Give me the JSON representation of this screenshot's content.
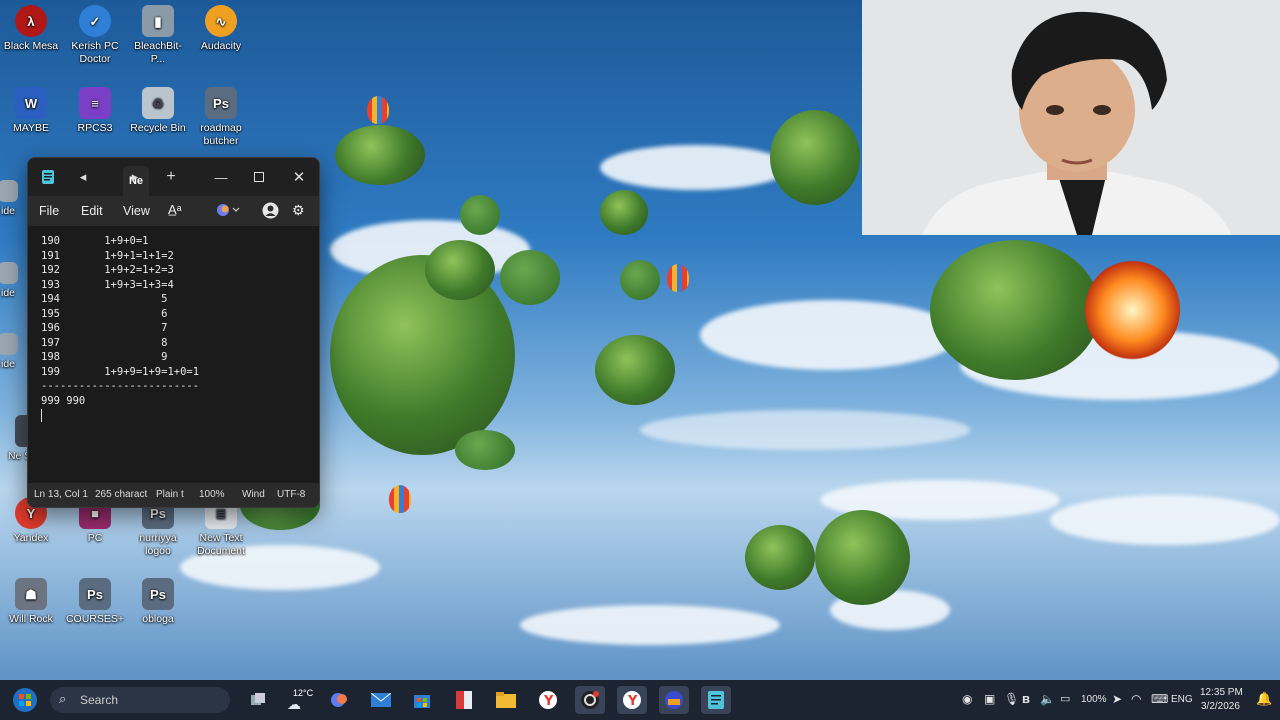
{
  "desktop_icons": [
    {
      "label": "Black Mesa",
      "icon": "black-mesa-icon",
      "color": "#b01818"
    },
    {
      "label": "Kerish PC Doctor",
      "icon": "kerish-icon",
      "color": "#2f7fd6"
    },
    {
      "label": "BleachBit-P...",
      "icon": "bleachbit-icon",
      "color": "#8a9aa8"
    },
    {
      "label": "Audacity",
      "icon": "audacity-icon",
      "color": "#f0a020"
    },
    {
      "label": "MAYBE",
      "icon": "word-icon",
      "color": "#2b5fbf"
    },
    {
      "label": "RPCS3",
      "icon": "rpcs3-icon",
      "color": "#7a3fc4"
    },
    {
      "label": "Recycle Bin",
      "icon": "recycle-bin-icon",
      "color": "#b9c4cc"
    },
    {
      "label": "roadmap butcher",
      "icon": "photoshop-icon",
      "color": "#5b6c80"
    },
    {
      "label": "ide",
      "icon": "file-icon",
      "color": "#9aa6b2"
    },
    {
      "label": "ide",
      "icon": "file-icon",
      "color": "#9aa6b2"
    },
    {
      "label": "ide",
      "icon": "file-icon",
      "color": "#9aa6b2"
    },
    {
      "label": "Ne Speec",
      "icon": "speech-icon",
      "color": "#444c58"
    },
    {
      "label": "Yandex",
      "icon": "yandex-icon",
      "color": "#e23b2e"
    },
    {
      "label": "PC",
      "icon": "pc-icon",
      "color": "#9b2c6e"
    },
    {
      "label": "nurriyya logoo",
      "icon": "photoshop-icon",
      "color": "#5b6c80"
    },
    {
      "label": "New Text Document",
      "icon": "text-file-icon",
      "color": "#e9edf1"
    },
    {
      "label": "Will Rock",
      "icon": "will-rock-icon",
      "color": "#6b7480"
    },
    {
      "label": "COURSES+",
      "icon": "photoshop-icon",
      "color": "#5b6c80"
    },
    {
      "label": "obloga",
      "icon": "photoshop-icon",
      "color": "#5b6c80"
    }
  ],
  "notepad": {
    "tab_label": "Ne",
    "menu": {
      "file": "File",
      "edit": "Edit",
      "view": "View"
    },
    "lines": [
      {
        "num": "190",
        "text": "1+9+0=1"
      },
      {
        "num": "191",
        "text": "1+9+1=1+1=2"
      },
      {
        "num": "192",
        "text": "1+9+2=1+2=3"
      },
      {
        "num": "193",
        "text": "1+9+3=1+3=4"
      },
      {
        "num": "194",
        "text": "         5"
      },
      {
        "num": "195",
        "text": "         6"
      },
      {
        "num": "196",
        "text": "         7"
      },
      {
        "num": "197",
        "text": "         8"
      },
      {
        "num": "198",
        "text": "         9"
      },
      {
        "num": "199",
        "text": "1+9+9=1+9=1+0=1"
      }
    ],
    "separator": "-------------------------",
    "result": "999 990",
    "status": {
      "position": "Ln 13, Col 1",
      "chars": "265 charact",
      "format": "Plain t",
      "zoom": "100%",
      "eol": "Wind",
      "encoding": "UTF-8"
    }
  },
  "taskbar": {
    "search_placeholder": "Search",
    "weather": "12°C",
    "battery": "100%",
    "language": "ENG",
    "time": "12:35 PM",
    "date": "3/2/2026"
  }
}
